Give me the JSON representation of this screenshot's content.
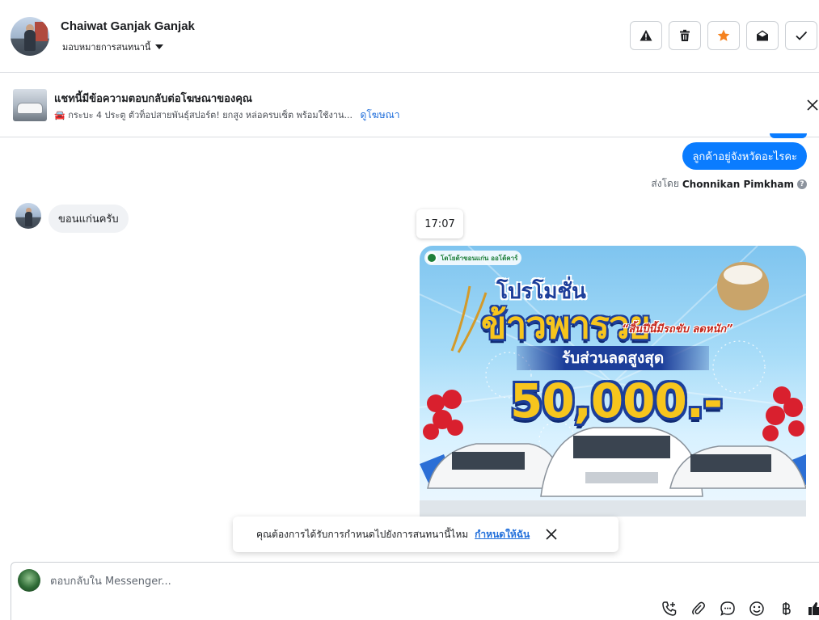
{
  "header": {
    "name": "Chaiwat Ganjak Ganjak",
    "assign_label": "มอบหมายการสนทนานี้",
    "actions": [
      "report-spam",
      "delete",
      "star",
      "mark-unread",
      "mark-done"
    ]
  },
  "ad_banner": {
    "title": "แชทนี้มีข้อความตอบกลับต่อโฆษณาของคุณ",
    "text": "🚘 กระบะ 4 ประตู ตัวท็อปสายพันธุ์สปอร์ต! ยกสูง หล่อครบเซ็ต พร้อมใช้งาน...",
    "link": "ดูโฆษณา"
  },
  "messages": {
    "outgoing_text": "ลูกค้าอยู่จังหวัดอะไรคะ",
    "sent_by_prefix": "ส่งโดย",
    "sent_by_name": "Chonnikan Pimkham",
    "incoming_text": "ขอนแก่นครับ",
    "timestamp": "17:07"
  },
  "promo": {
    "logo_text": "โตโยต้าขอนแก่น ออโต้คาร์",
    "title_small": "โปรโมชั่น",
    "title_big": "ข้าวพารวย",
    "tagline": "“สิ้นปีนี้มีรถขับ ลดหนัก”",
    "banner": "รับส่วนลดสูงสุด",
    "amount": "50,000.-"
  },
  "reminder": {
    "text": "คุณต้องการได้รับการกำหนดไปยังการสนทนานี้ไหม",
    "link": "กำหนดให้ฉัน"
  },
  "composer": {
    "placeholder": "ตอบกลับใน Messenger..."
  },
  "colors": {
    "accent": "#0a7cff",
    "link": "#216fdb",
    "star": "#f5821f"
  }
}
